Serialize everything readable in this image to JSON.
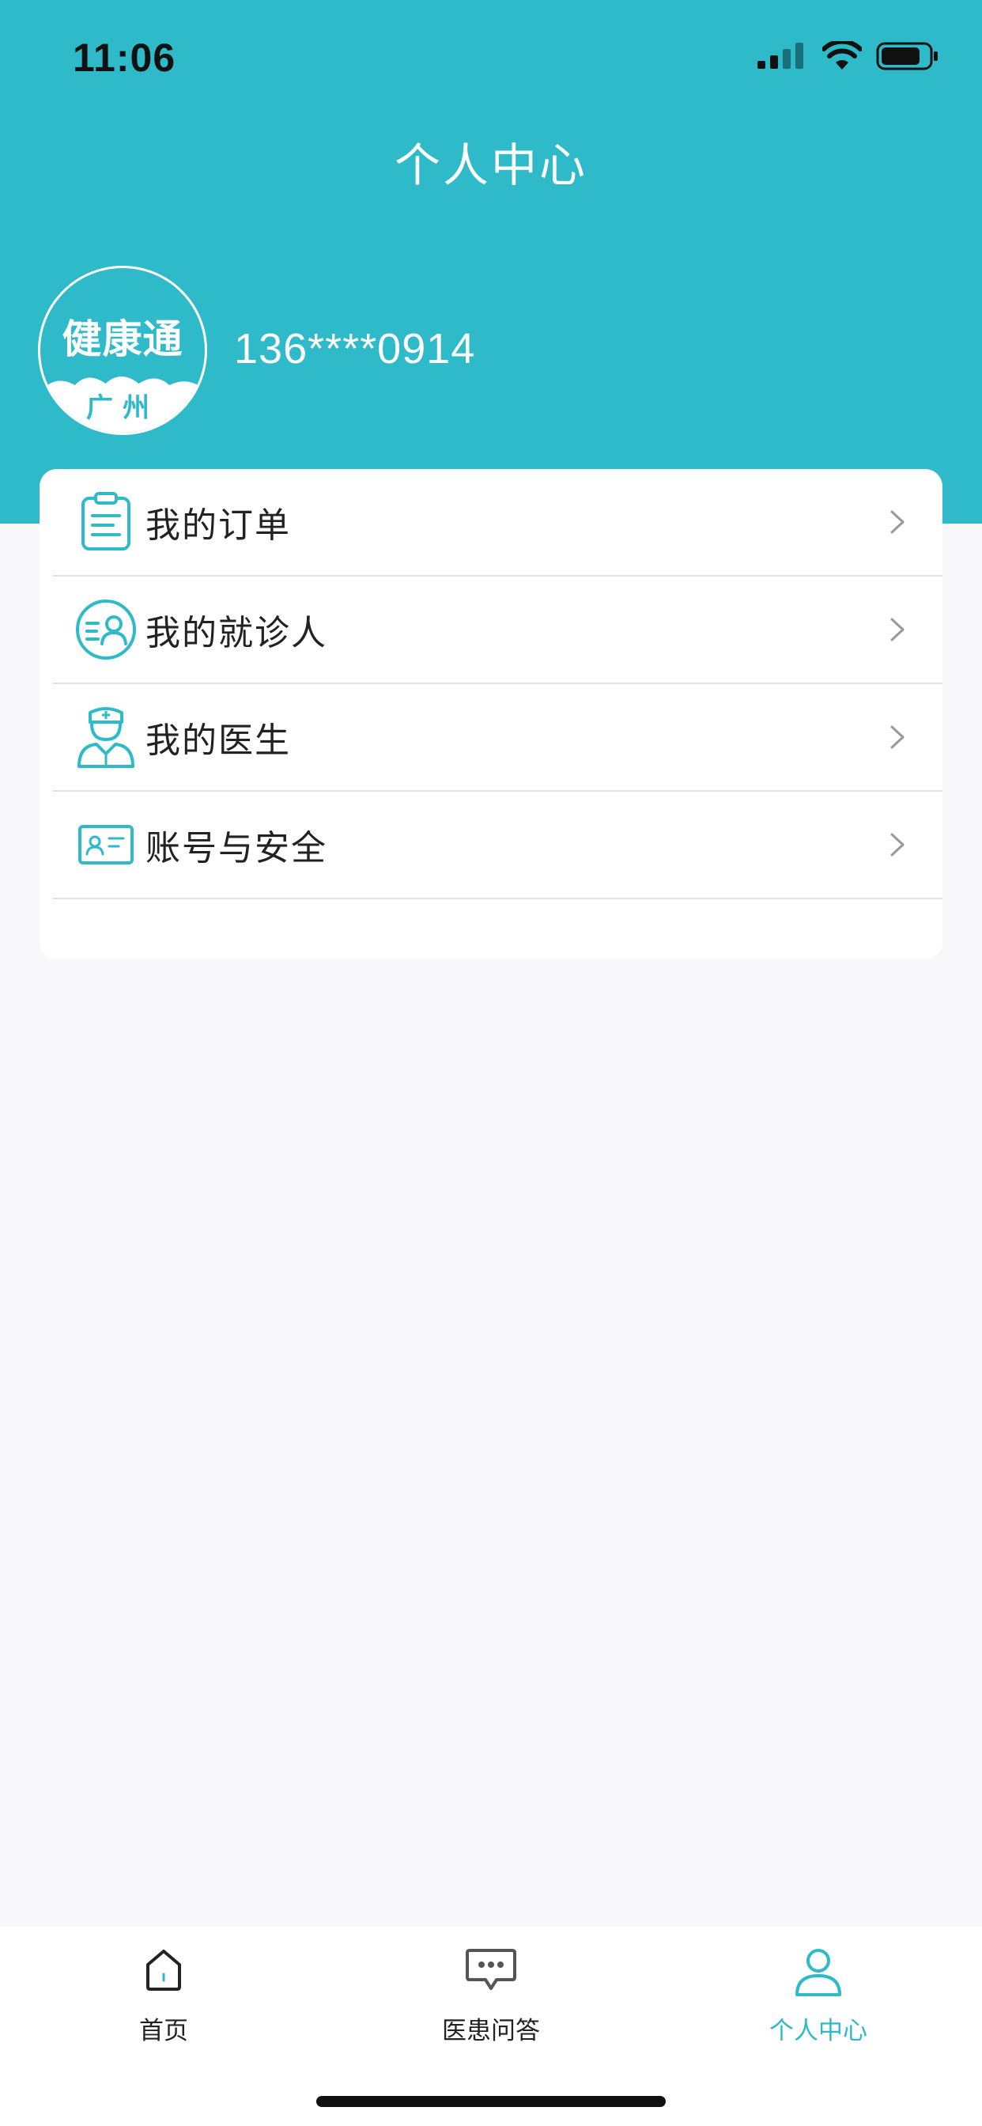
{
  "status_bar": {
    "time": "11:06"
  },
  "header": {
    "title": "个人中心"
  },
  "profile": {
    "avatar_line1": "健康通",
    "avatar_line2": "广州",
    "phone": "136****0914"
  },
  "menu": {
    "items": [
      {
        "label": "我的订单",
        "icon": "clipboard-icon"
      },
      {
        "label": "我的就诊人",
        "icon": "patient-icon"
      },
      {
        "label": "我的医生",
        "icon": "doctor-icon"
      },
      {
        "label": "账号与安全",
        "icon": "id-card-icon"
      }
    ]
  },
  "tabbar": {
    "tabs": [
      {
        "label": "首页",
        "icon": "home-icon"
      },
      {
        "label": "医患问答",
        "icon": "chat-bubble-icon"
      },
      {
        "label": "个人中心",
        "icon": "person-icon",
        "active": true
      }
    ]
  },
  "colors": {
    "accent": "#2fbaca",
    "background": "#f8f8fa",
    "text": "#222222"
  }
}
